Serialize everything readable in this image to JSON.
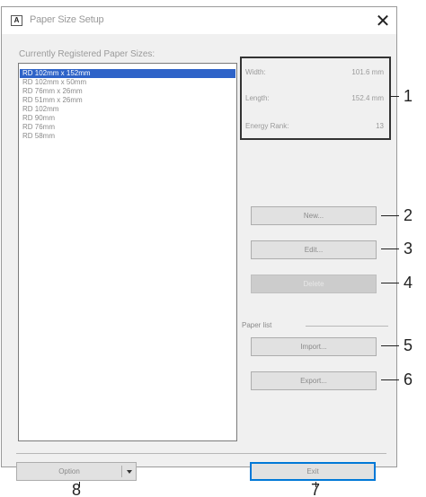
{
  "window": {
    "title": "Paper Size Setup",
    "icon_text": "A",
    "close_glyph": "✕"
  },
  "list": {
    "label": "Currently Registered Paper Sizes:",
    "items": [
      "RD 102mm x 152mm",
      "RD 102mm x 50mm",
      "RD 76mm x 26mm",
      "RD 51mm x 26mm",
      "RD 102mm",
      "RD 90mm",
      "RD 76mm",
      "RD 58mm"
    ],
    "selected_index": 0
  },
  "info": {
    "width_label": "Width:",
    "width_value": "101.6 mm",
    "length_label": "Length:",
    "length_value": "152.4 mm",
    "energy_label": "Energy Rank:",
    "energy_value": "13"
  },
  "buttons": {
    "new": "New...",
    "edit": "Edit...",
    "delete": "Delete",
    "import": "Import...",
    "export": "Export...",
    "option": "Option",
    "exit": "Exit"
  },
  "paper_list_label": "Paper list",
  "callouts": [
    "1",
    "2",
    "3",
    "4",
    "5",
    "6",
    "7",
    "8"
  ],
  "colors": {
    "selection": "#2e63c8",
    "default_button_border": "#0078d7",
    "dialog_bg": "#f0f0f0"
  }
}
